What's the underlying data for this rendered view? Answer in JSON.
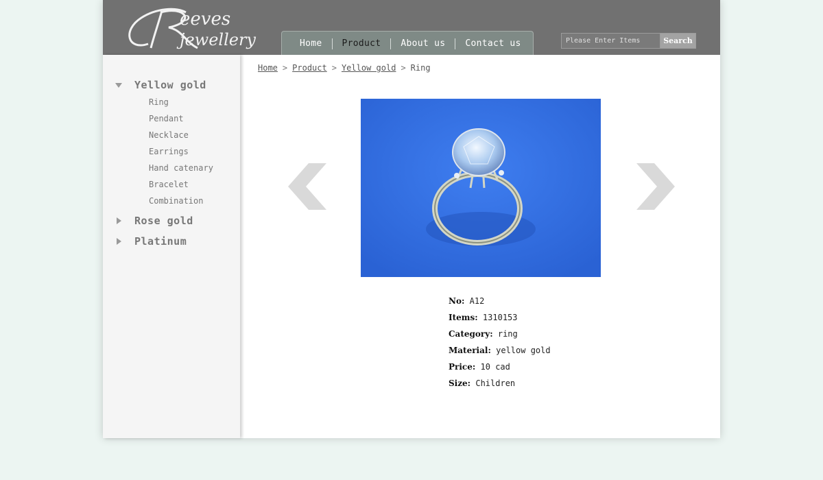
{
  "brand": {
    "logo_text_top": "Reeves",
    "logo_text_bottom": "jewellery"
  },
  "nav": {
    "items": [
      {
        "label": "Home"
      },
      {
        "label": "Product",
        "active": true
      },
      {
        "label": "About us"
      },
      {
        "label": "Contact us"
      }
    ]
  },
  "search": {
    "placeholder": "Please Enter Items",
    "button_label": "Search"
  },
  "sidebar": {
    "categories": [
      {
        "label": "Yellow gold",
        "expanded": true,
        "items": [
          "Ring",
          "Pendant",
          "Necklace",
          "Earrings",
          "Hand catenary",
          "Bracelet",
          "Combination"
        ]
      },
      {
        "label": "Rose gold",
        "expanded": false
      },
      {
        "label": "Platinum",
        "expanded": false
      }
    ]
  },
  "breadcrumb": {
    "home": "Home",
    "product": "Product",
    "category": "Yellow gold",
    "current": "Ring"
  },
  "product": {
    "image_icon": "ring-photo",
    "no_label": "No:",
    "no_value": "A12",
    "items_label": "Items:",
    "items_value": "1310153",
    "category_label": "Category:",
    "category_value": "ring",
    "material_label": "Material:",
    "material_value": "yellow gold",
    "price_label": "Price:",
    "price_value": "10 cad",
    "size_label": "Size:",
    "size_value": "Children"
  },
  "colors": {
    "header": "#717171",
    "page_bg": "#ecf5f2",
    "photo_bg": "#2f6fdf",
    "arrow": "#d9d9d9"
  },
  "icons": {
    "prev": "chevron-left-icon",
    "next": "chevron-right-icon",
    "expanded": "triangle-down-icon",
    "collapsed": "triangle-right-icon"
  }
}
